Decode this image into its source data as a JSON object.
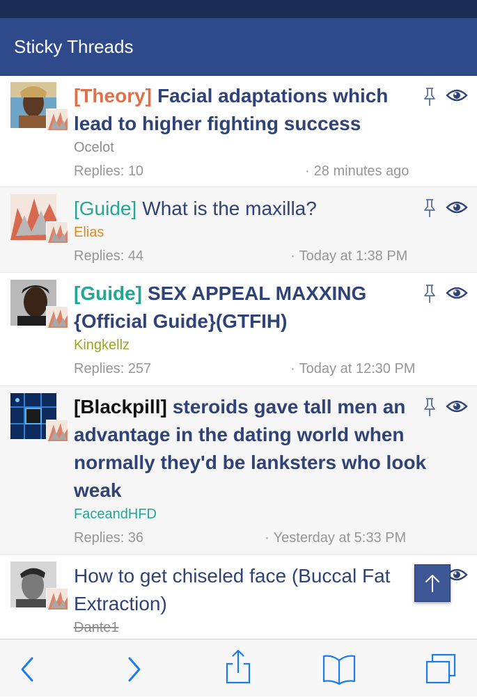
{
  "header": {
    "title": "Sticky Threads"
  },
  "threads": [
    {
      "prefix": "[Theory]",
      "prefix_color": "#e0704a",
      "title": "Facial adaptations which lead to higher fighting success",
      "author": "Ocelot",
      "author_color": "#8c8c8c",
      "replies": "Replies: 10",
      "time": "28 minutes ago"
    },
    {
      "prefix": "[Guide]",
      "prefix_color": "#22a794",
      "title": "What is the maxilla?",
      "author": "Elias",
      "author_color": "#e08a1e",
      "replies": "Replies: 44",
      "time": "Today at 1:38 PM"
    },
    {
      "prefix": "[Guide]",
      "prefix_color": "#22a794",
      "title": "SEX APPEAL MAXXING {Official Guide}(GTFIH)",
      "author": "Kingkellz",
      "author_color": "#a3a21a",
      "replies": "Replies: 257",
      "time": "Today at 12:30 PM"
    },
    {
      "prefix": "[Blackpill]",
      "prefix_color": "#111111",
      "title": "steroids gave tall men an advantage in the dating world when normally they'd be lanksters who look weak",
      "author": "FaceandHFD",
      "author_color": "#22a794",
      "replies": "Replies: 36",
      "time": "Yesterday at 5:33 PM"
    },
    {
      "prefix": "",
      "title": "How to get chiseled face (Buccal Fat Extraction)",
      "author": "Dante1",
      "author_color": "#8c8c8c"
    }
  ],
  "time_separator": "·",
  "toolbar": {
    "icons": [
      "back-icon",
      "forward-icon",
      "share-icon",
      "bookmarks-icon",
      "tabs-icon"
    ],
    "accent": "#1a7cf2"
  },
  "colors": {
    "header_bg": "#2f4a8a",
    "title": "#2f4377",
    "meta": "#969696"
  }
}
